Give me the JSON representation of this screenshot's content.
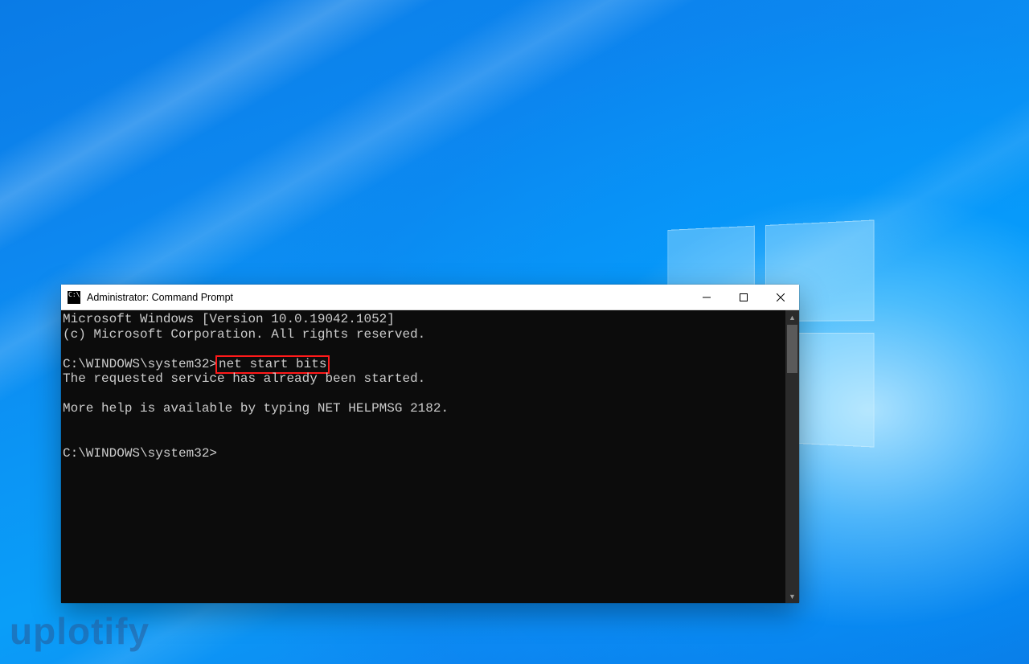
{
  "window": {
    "title": "Administrator: Command Prompt"
  },
  "terminal": {
    "line1": "Microsoft Windows [Version 10.0.19042.1052]",
    "line2": "(c) Microsoft Corporation. All rights reserved.",
    "blank1": "",
    "prompt1_prefix": "C:\\WINDOWS\\system32>",
    "prompt1_command": "net start bits",
    "response1": "The requested service has already been started.",
    "blank2": "",
    "response2": "More help is available by typing NET HELPMSG 2182.",
    "blank3": "",
    "blank4": "",
    "prompt2": "C:\\WINDOWS\\system32>"
  },
  "watermark": "uplotify"
}
